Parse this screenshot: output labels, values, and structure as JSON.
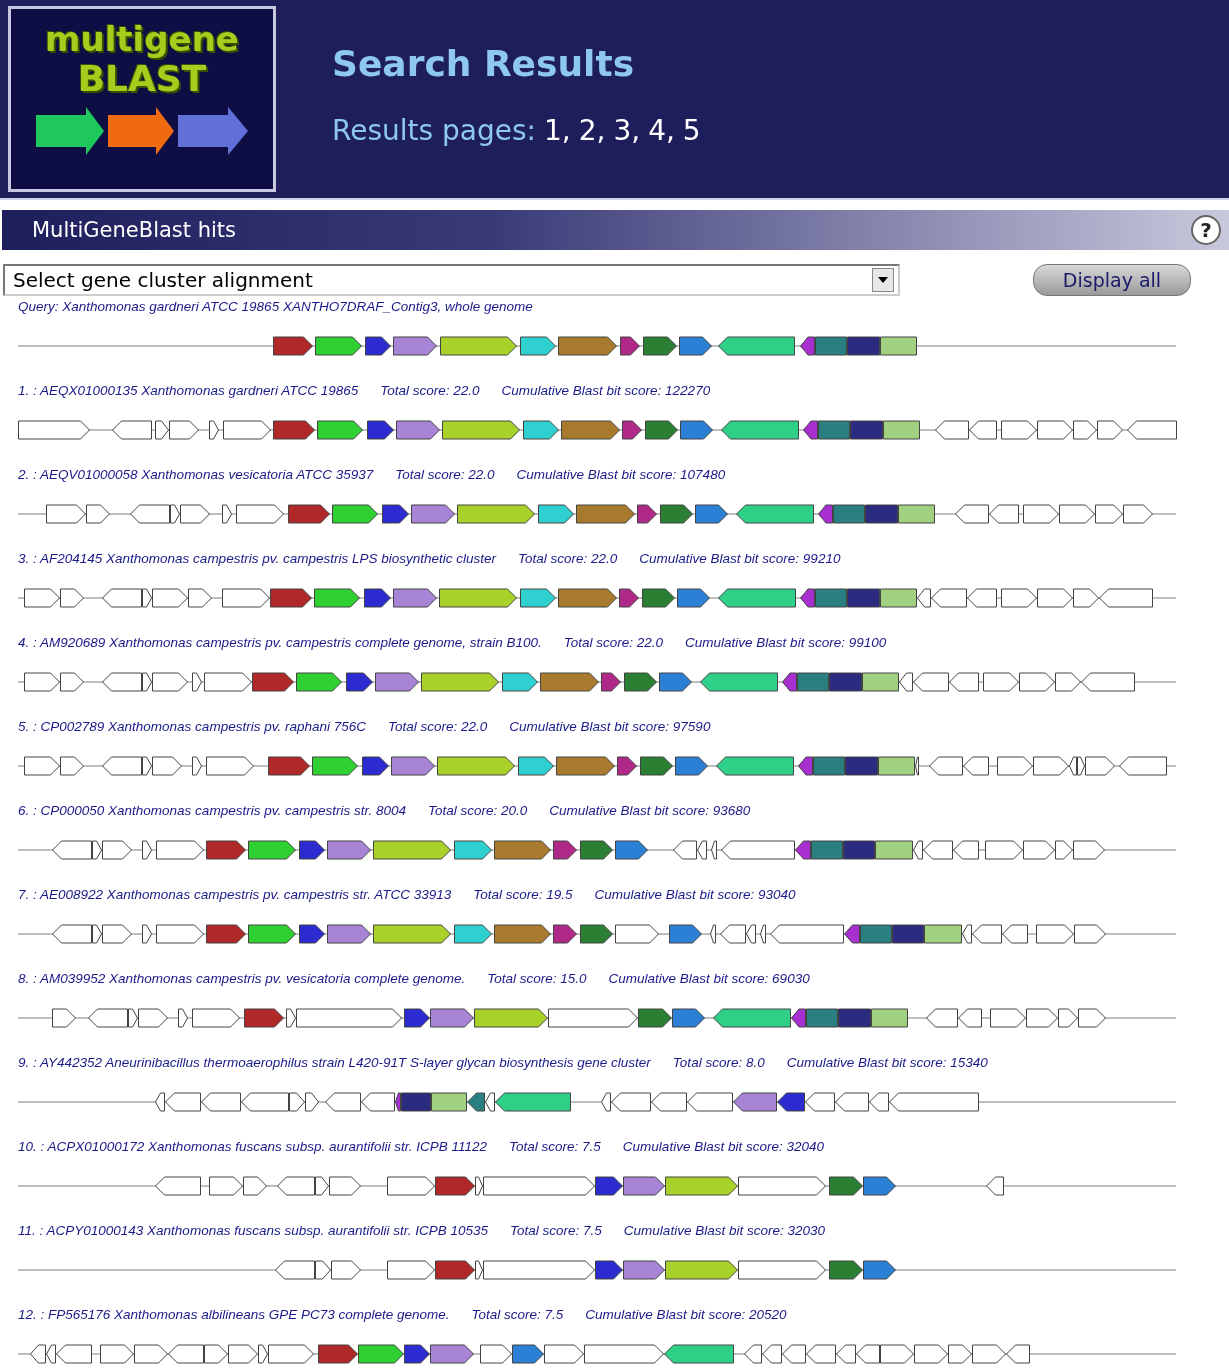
{
  "header": {
    "logo": {
      "line_1": "multigene",
      "line_2": "BLAST"
    },
    "title": "Search Results",
    "pages_label": "Results pages:",
    "pages": [
      "1,",
      "2,",
      "3,",
      "4,",
      "5"
    ]
  },
  "panel": {
    "title": "MultiGeneBlast hits",
    "help": "?"
  },
  "controls": {
    "select": "Select gene cluster alignment",
    "button": "Display all"
  },
  "query": {
    "label": "Query: Xanthomonas gardneri ATCC 19865 XANTHO7DRAF_Contig3, whole genome"
  },
  "hits": [
    {
      "title": "1. : AEQX01000135 Xanthomonas gardneri ATCC 19865",
      "total_score": "Total score: 22.0",
      "cumulative_score": "Cumulative Blast bit score: 122270"
    },
    {
      "title": "2. : AEQV01000058 Xanthomonas vesicatoria ATCC 35937",
      "total_score": "Total score: 22.0",
      "cumulative_score": "Cumulative Blast bit score: 107480"
    },
    {
      "title": "3. : AF204145 Xanthomonas campestris pv. campestris LPS biosynthetic cluster",
      "total_score": "Total score: 22.0",
      "cumulative_score": "Cumulative Blast bit score: 99210"
    },
    {
      "title": "4. : AM920689 Xanthomonas campestris pv. campestris complete genome, strain B100.",
      "total_score": "Total score: 22.0",
      "cumulative_score": "Cumulative Blast bit score: 99100"
    },
    {
      "title": "5. : CP002789 Xanthomonas campestris pv. raphani 756C",
      "total_score": "Total score: 22.0",
      "cumulative_score": "Cumulative Blast bit score: 97590"
    },
    {
      "title": "6. : CP000050 Xanthomonas campestris pv. campestris str. 8004",
      "total_score": "Total score: 20.0",
      "cumulative_score": "Cumulative Blast bit score: 93680"
    },
    {
      "title": "7. : AE008922 Xanthomonas campestris pv. campestris str. ATCC 33913",
      "total_score": "Total score: 19.5",
      "cumulative_score": "Cumulative Blast bit score: 93040"
    },
    {
      "title": "8. : AM039952 Xanthomonas campestris pv. vesicatoria complete genome.",
      "total_score": "Total score: 15.0",
      "cumulative_score": "Cumulative Blast bit score: 69030"
    },
    {
      "title": "9. : AY442352 Aneurinibacillus thermoaerophilus strain L420-91T S-layer glycan biosynthesis gene cluster",
      "total_score": "Total score: 8.0",
      "cumulative_score": "Cumulative Blast bit score: 15340"
    },
    {
      "title": "10. : ACPX01000172 Xanthomonas fuscans subsp. aurantifolii str. ICPB 11122",
      "total_score": "Total score: 7.5",
      "cumulative_score": "Cumulative Blast bit score: 32040"
    },
    {
      "title": "11. : ACPY01000143 Xanthomonas fuscans subsp. aurantifolii str. ICPB 10535",
      "total_score": "Total score: 7.5",
      "cumulative_score": "Cumulative Blast bit score: 32030"
    },
    {
      "title": "12. : FP565176 Xanthomonas albilineans GPE PC73 complete genome.",
      "total_score": "Total score: 7.5",
      "cumulative_score": "Cumulative Blast bit score: 20520"
    }
  ]
}
